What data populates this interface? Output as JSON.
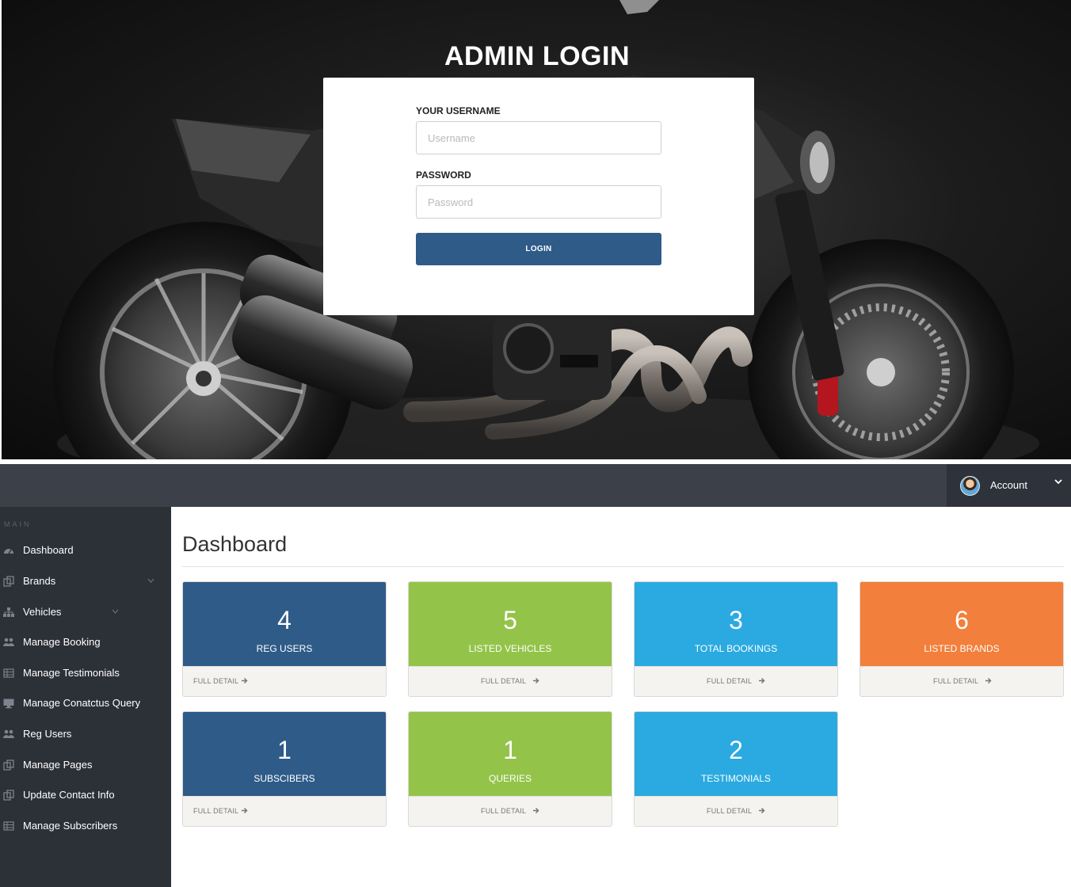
{
  "login": {
    "title": "ADMIN LOGIN",
    "username_label": "YOUR USERNAME",
    "username_placeholder": "Username",
    "username_value": "",
    "password_label": "PASSWORD",
    "password_placeholder": "Password",
    "password_value": "",
    "button_label": "LOGIN",
    "background_image": "motorcycle-photo",
    "colors": {
      "button": "#2e5b88"
    }
  },
  "topbar": {
    "account_label": "Account",
    "icons": {
      "avatar": "user-avatar",
      "chevron": "chevron-down-icon"
    },
    "colors": {
      "bar": "#3b4049",
      "account": "#2e333b"
    }
  },
  "sidebar": {
    "heading": "MAIN",
    "items": [
      {
        "label": "Dashboard",
        "icon": "dashboard-icon"
      },
      {
        "label": "Brands",
        "icon": "files-icon",
        "has_submenu": true
      },
      {
        "label": "Vehicles",
        "icon": "sitemap-icon",
        "has_submenu": true
      },
      {
        "label": "Manage Booking",
        "icon": "users-icon"
      },
      {
        "label": "Manage Testimonials",
        "icon": "table-icon"
      },
      {
        "label": "Manage Conatctus Query",
        "icon": "desktop-icon"
      },
      {
        "label": "Reg Users",
        "icon": "users-icon"
      },
      {
        "label": "Manage Pages",
        "icon": "files-icon"
      },
      {
        "label": "Update Contact Info",
        "icon": "files-icon"
      },
      {
        "label": "Manage Subscribers",
        "icon": "table-icon"
      }
    ],
    "colors": {
      "background": "#2c3037"
    }
  },
  "main": {
    "title": "Dashboard",
    "full_detail_label": "FULL DETAIL",
    "cards": [
      {
        "value": "4",
        "label": "REG USERS",
        "color": "#2e5b88"
      },
      {
        "value": "5",
        "label": "LISTED VEHICLES",
        "color": "#94c34a"
      },
      {
        "value": "3",
        "label": "TOTAL BOOKINGS",
        "color": "#2aaae0"
      },
      {
        "value": "6",
        "label": "LISTED BRANDS",
        "color": "#f27f3b"
      },
      {
        "value": "1",
        "label": "SUBSCIBERS",
        "color": "#2e5b88"
      },
      {
        "value": "1",
        "label": "QUERIES",
        "color": "#94c34a"
      },
      {
        "value": "2",
        "label": "TESTIMONIALS",
        "color": "#2aaae0"
      }
    ]
  }
}
